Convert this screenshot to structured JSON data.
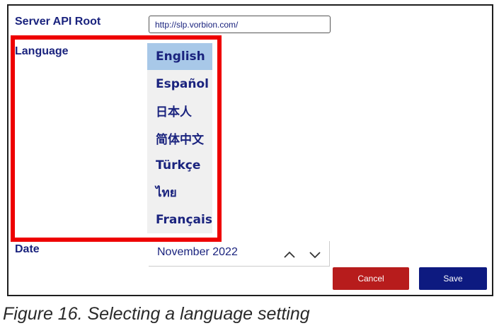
{
  "form": {
    "server_api_root_label": "Server API Root",
    "server_api_root_value": "http://slp.vorbion.com/",
    "language_label": "Language",
    "date_label": "Date",
    "date_value": "November 2022"
  },
  "language_dropdown": {
    "selected": "English",
    "options": [
      "English",
      "Español",
      "日本人",
      "简体中文",
      "Türkçe",
      "ไทย",
      "Français"
    ]
  },
  "buttons": {
    "cancel_label": "Cancel",
    "save_label": "Save"
  },
  "caption": "Figure 16. Selecting a language setting",
  "colors": {
    "label_text": "#1a237e",
    "highlight_border": "#ee0000",
    "selected_option_bg": "#a8c8e8",
    "cancel_button": "#b71c1c",
    "save_button": "#0d1a80"
  }
}
